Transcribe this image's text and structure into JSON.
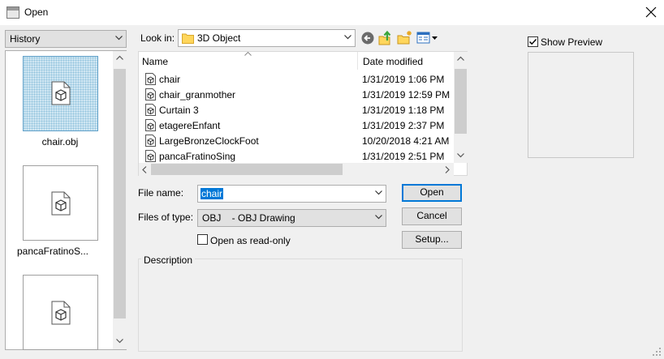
{
  "window": {
    "title": "Open"
  },
  "history": {
    "label": "History",
    "items": [
      {
        "label": "chair.obj",
        "icon": "obj-file-icon",
        "selected": true
      },
      {
        "label": "pancaFratinoS...",
        "icon": "obj-file-icon",
        "selected": false
      },
      {
        "label": "",
        "icon": "obj-file-icon",
        "selected": false
      }
    ]
  },
  "toolbar": {
    "look_in_label": "Look in:",
    "folder": "3D Object"
  },
  "list": {
    "col_name": "Name",
    "col_date": "Date modified",
    "rows": [
      {
        "name": "chair",
        "date": "1/31/2019 1:06 PM"
      },
      {
        "name": "chair_granmother",
        "date": "1/31/2019 12:59 PM"
      },
      {
        "name": "Curtain 3",
        "date": "1/31/2019 1:18 PM"
      },
      {
        "name": "etagereEnfant",
        "date": "1/31/2019 2:37 PM"
      },
      {
        "name": "LargeBronzeClockFoot",
        "date": "10/20/2018 4:21 AM"
      },
      {
        "name": "pancaFratinoSing",
        "date": "1/31/2019 2:51 PM"
      }
    ]
  },
  "form": {
    "file_name_label": "File name:",
    "file_name_value": "chair",
    "type_label": "Files of type:",
    "type_value": "OBJ    - OBJ Drawing",
    "readonly_label": "Open as read-only",
    "readonly_checked": false
  },
  "buttons": {
    "open": "Open",
    "cancel": "Cancel",
    "setup": "Setup..."
  },
  "preview": {
    "label": "Show Preview",
    "checked": true
  },
  "description": {
    "label": "Description"
  },
  "colors": {
    "selection": "#0078d7",
    "accent_green": "#3aa53a",
    "folder": "#ffd65c"
  }
}
